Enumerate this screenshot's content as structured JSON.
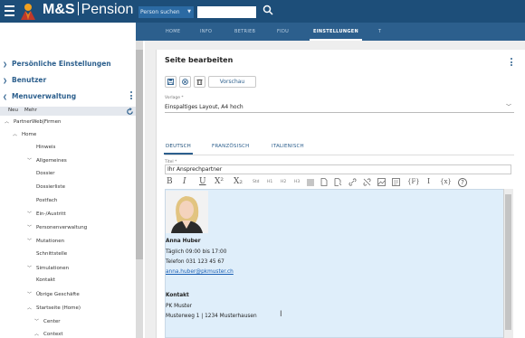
{
  "app": {
    "brand_left": "M&S",
    "brand_right": "Pension"
  },
  "header": {
    "person_select": "Person suchen",
    "search_value": "",
    "tabs": [
      {
        "label": "HOME",
        "active": false
      },
      {
        "label": "INFO",
        "active": false
      },
      {
        "label": "BETRIEB",
        "active": false
      },
      {
        "label": "FIDU",
        "active": false
      },
      {
        "label": "EINSTELLUNGEN",
        "active": true
      },
      {
        "label": "T",
        "active": false
      }
    ]
  },
  "sidebar": {
    "sections": [
      "Persönliche Einstellungen",
      "Benutzer",
      "Menuverwaltung"
    ],
    "new_label": "Neu",
    "more_label": "Mehr",
    "tree": [
      {
        "label": "PartnerWeb|Firmen",
        "level": 0,
        "chevron": "up"
      },
      {
        "label": "Home",
        "level": 1,
        "chevron": "up"
      },
      {
        "label": "Hinweis",
        "level": 2,
        "chevron": ""
      },
      {
        "label": "Allgemeines",
        "level": 2,
        "chevron": "down"
      },
      {
        "label": "Dossier",
        "level": 2,
        "chevron": ""
      },
      {
        "label": "Dossierliste",
        "level": 2,
        "chevron": ""
      },
      {
        "label": "Postfach",
        "level": 2,
        "chevron": ""
      },
      {
        "label": "Ein-/Austritt",
        "level": 2,
        "chevron": "down"
      },
      {
        "label": "Personenverwaltung",
        "level": 2,
        "chevron": "down"
      },
      {
        "label": "Mutationen",
        "level": 2,
        "chevron": "down"
      },
      {
        "label": "Schnittstelle",
        "level": 2,
        "chevron": ""
      },
      {
        "label": "Simulationen",
        "level": 2,
        "chevron": "down"
      },
      {
        "label": "Kontakt",
        "level": 2,
        "chevron": ""
      },
      {
        "label": "Übrige Geschäfte",
        "level": 2,
        "chevron": "down"
      },
      {
        "label": "Startseite (Home)",
        "level": 2,
        "chevron": "up"
      },
      {
        "label": "Center",
        "level": 3,
        "chevron": "down"
      },
      {
        "label": "Context",
        "level": 3,
        "chevron": "up"
      }
    ]
  },
  "main": {
    "title": "Seite bearbeiten",
    "preview_label": "Vorschau",
    "template_label": "Vorlage *",
    "template_value": "Einspaltiges Layout, A4 hoch",
    "language_tabs": [
      {
        "label": "DEUTSCH",
        "active": true
      },
      {
        "label": "FRANZÖSISCH",
        "active": false
      },
      {
        "label": "ITALIENISCH",
        "active": false
      }
    ],
    "title_field_label": "Titel *",
    "title_field_value": "Ihr Ansprechpartner",
    "toolbar": {
      "bold": "B",
      "italic": "I",
      "underline": "U",
      "superscript": "X²",
      "subscript": "X₂",
      "std": "Std",
      "h1": "H1",
      "h2": "H2",
      "h3": "H3",
      "vars": "{F}",
      "cursor": "I",
      "code": "{x}",
      "help": "?"
    },
    "content": {
      "name": "Anna Huber",
      "hours": "Täglich 09:00 bis 17:00",
      "phone": "Telefon 031 123 45 67",
      "email": "anna.huber@pkmuster.ch",
      "contact_heading": "Kontakt",
      "org": "PK Muster",
      "address": "Musterweg 1 | 1234 Musterhausen"
    }
  },
  "colors": {
    "header": "#1d4e79",
    "nav": "#2c5f8d",
    "accent": "#2c5f8d",
    "editor_bg": "#dfeefa"
  }
}
